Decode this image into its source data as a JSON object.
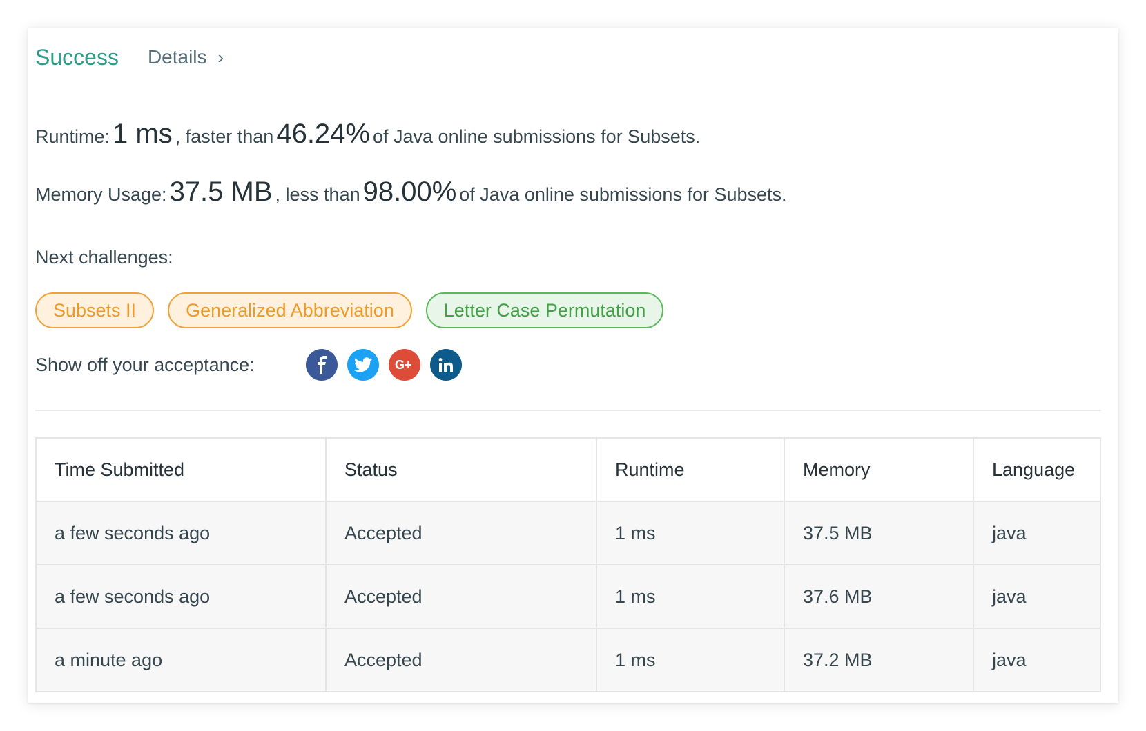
{
  "header": {
    "status": "Success",
    "details_label": "Details",
    "chevron": "chevron-right-icon"
  },
  "runtime": {
    "label": "Runtime:",
    "value": "1 ms",
    "comparator": ", faster than",
    "percent": "46.24%",
    "suffix": "of Java online submissions for Subsets."
  },
  "memory": {
    "label": "Memory Usage:",
    "value": "37.5 MB",
    "comparator": ", less than",
    "percent": "98.00%",
    "suffix": "of Java online submissions for Subsets."
  },
  "next_challenges": {
    "label": "Next challenges:",
    "items": [
      {
        "label": "Subsets II",
        "difficulty": "medium"
      },
      {
        "label": "Generalized Abbreviation",
        "difficulty": "medium"
      },
      {
        "label": "Letter Case Permutation",
        "difficulty": "easy"
      }
    ]
  },
  "share": {
    "label": "Show off your acceptance:",
    "icons": [
      "facebook-icon",
      "twitter-icon",
      "google-plus-icon",
      "linkedin-icon"
    ]
  },
  "table": {
    "headers": [
      "Time Submitted",
      "Status",
      "Runtime",
      "Memory",
      "Language"
    ],
    "rows": [
      [
        "a few seconds ago",
        "Accepted",
        "1 ms",
        "37.5 MB",
        "java"
      ],
      [
        "a few seconds ago",
        "Accepted",
        "1 ms",
        "37.6 MB",
        "java"
      ],
      [
        "a minute ago",
        "Accepted",
        "1 ms",
        "37.2 MB",
        "java"
      ]
    ]
  },
  "colors": {
    "success": "#2e9c88",
    "medium_pill_bg": "#fff1de",
    "medium_pill_border": "#f0a23a",
    "easy_pill_bg": "#e8f5e9",
    "easy_pill_border": "#5cb85c",
    "facebook": "#3b5998",
    "twitter": "#1da1f2",
    "google_plus": "#dd4b39",
    "linkedin": "#0e5a8a"
  }
}
